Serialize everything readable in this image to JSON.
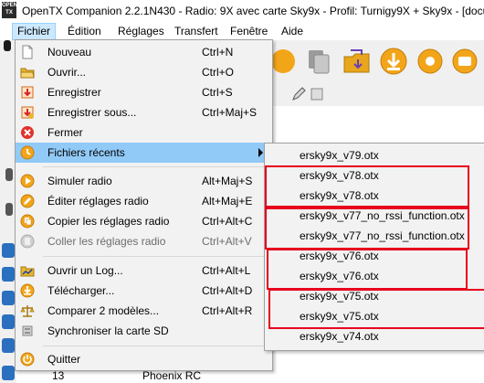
{
  "window": {
    "title": "OpenTX Companion 2.2.1N430 - Radio: 9X avec carte Sky9x - Profil: Turnigy9X + Sky9x - [docum",
    "icon_text_1": "OPEN",
    "icon_text_2": "TX"
  },
  "menubar": [
    {
      "label": "Fichier"
    },
    {
      "label": "Édition"
    },
    {
      "label": "Réglages"
    },
    {
      "label": "Transfert"
    },
    {
      "label": "Fenêtre"
    },
    {
      "label": "Aide"
    }
  ],
  "file_menu": {
    "items": [
      {
        "label": "Nouveau",
        "shortcut": "Ctrl+N",
        "icon": "new-file-icon"
      },
      {
        "label": "Ouvrir...",
        "shortcut": "Ctrl+O",
        "icon": "open-folder-icon"
      },
      {
        "label": "Enregistrer",
        "shortcut": "Ctrl+S",
        "icon": "save-icon"
      },
      {
        "label": "Enregistrer sous...",
        "shortcut": "Ctrl+Maj+S",
        "icon": "save-as-icon"
      },
      {
        "label": "Fermer",
        "shortcut": "",
        "icon": "close-icon"
      },
      {
        "label": "Fichiers récents",
        "shortcut": "",
        "icon": "recent-files-icon"
      },
      {
        "label": "Simuler radio",
        "shortcut": "Alt+Maj+S",
        "icon": "simulate-icon"
      },
      {
        "label": "Éditer réglages radio",
        "shortcut": "Alt+Maj+E",
        "icon": "edit-settings-icon"
      },
      {
        "label": "Copier les réglages radio",
        "shortcut": "Ctrl+Alt+C",
        "icon": "copy-settings-icon"
      },
      {
        "label": "Coller les réglages radio",
        "shortcut": "Ctrl+Alt+V",
        "icon": "paste-settings-icon"
      },
      {
        "label": "Ouvrir un Log...",
        "shortcut": "Ctrl+Alt+L",
        "icon": "open-log-icon"
      },
      {
        "label": "Télécharger...",
        "shortcut": "Ctrl+Alt+D",
        "icon": "download-icon"
      },
      {
        "label": "Comparer 2 modèles...",
        "shortcut": "Ctrl+Alt+R",
        "icon": "compare-icon"
      },
      {
        "label": "Synchroniser la carte SD",
        "shortcut": "",
        "icon": "sync-sd-icon"
      },
      {
        "label": "Quitter",
        "shortcut": "",
        "icon": "quit-icon"
      }
    ]
  },
  "recent_files": [
    "ersky9x_v79.otx",
    "ersky9x_v78.otx",
    "ersky9x_v78.otx",
    "ersky9x_v77_no_rssi_function.otx",
    "ersky9x_v77_no_rssi_function.otx",
    "ersky9x_v76.otx",
    "ersky9x_v76.otx",
    "ersky9x_v75.otx",
    "ersky9x_v75.otx",
    "ersky9x_v74.otx"
  ],
  "background_row": {
    "index": "13",
    "name": "Phoenix RC"
  },
  "colors": {
    "highlight": "#91c9f7",
    "menubar_active": "#cce8ff",
    "annotation_red": "#e8001c",
    "disabled_text": "#6d6d6d"
  }
}
